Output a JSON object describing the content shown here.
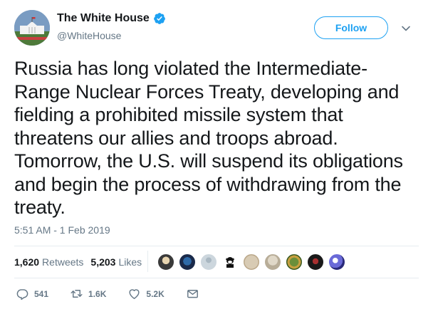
{
  "header": {
    "display_name": "The White House",
    "handle": "@WhiteHouse",
    "follow_label": "Follow",
    "verified": true
  },
  "tweet": {
    "text": "Russia has long violated the Intermediate-Range Nuclear Forces Treaty, developing and fielding a prohibited missile system that threatens our allies and troops abroad. Tomorrow, the U.S. will suspend its obligations and begin the process of withdrawing from the treaty.",
    "timestamp": "5:51 AM - 1 Feb 2019"
  },
  "stats": {
    "retweets_count": "1,620",
    "retweets_label": "Retweets",
    "likes_count": "5,203",
    "likes_label": "Likes",
    "liker_avatars": 10
  },
  "actions": {
    "replies": "541",
    "retweets": "1.6K",
    "likes": "5.2K"
  },
  "colors": {
    "accent": "#1da1f2",
    "muted": "#657786",
    "text": "#14171a",
    "divider": "#e6ecf0"
  }
}
